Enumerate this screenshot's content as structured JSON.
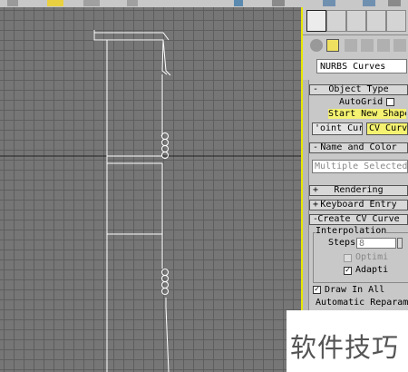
{
  "toolbar": {
    "icons": [
      "move-icon",
      "zoom-icon",
      "viewport-icon",
      "link-icon",
      "render-icon",
      "teapot-icon"
    ]
  },
  "panel": {
    "tabs": [
      "create-tab-icon",
      "modify-tab-icon",
      "hierarchy-tab-icon",
      "motion-tab-icon",
      "display-tab-icon"
    ],
    "sub_icons": [
      "geometry-icon",
      "shapes-icon",
      "lights-icon",
      "cameras-icon",
      "helpers-icon",
      "spacewarps-icon"
    ],
    "category_dropdown": "NURBS Curves",
    "object_type": {
      "header": "Object Type",
      "sign": "-",
      "autogrid_label": "AutoGrid",
      "start_new_shape_label": "Start New Shape",
      "point_curve_label": "'oint Curve",
      "cv_curve_label": "CV Curv"
    },
    "name_and_color": {
      "header": "Name and Color",
      "sign": "-",
      "name_value": "Multiple Selected"
    },
    "rendering": {
      "header": "Rendering",
      "sign": "+"
    },
    "keyboard_entry": {
      "header": "Keyboard Entry",
      "sign": "+"
    },
    "create_cv_curve": {
      "header": "Create CV Curve",
      "sign": "-",
      "interpolation_label": "Interpolation",
      "steps_label": "Steps:",
      "steps_value": "8",
      "optimize_label": "Optimi",
      "adaptive_label": "Adapti",
      "adaptive_checked": "✓",
      "draw_in_all_label": "Draw In All",
      "draw_in_all_checked": "✓",
      "auto_reparam_label": "Automatic Reparame"
    }
  },
  "watermark": "软件技巧",
  "colors": {
    "viewport_bg": "#767676",
    "grid": "#5e5e5e",
    "shape": "#ffffff",
    "active_border": "#e8e800",
    "panel_bg": "#c8c8c8",
    "highlight": "#f4f270"
  }
}
